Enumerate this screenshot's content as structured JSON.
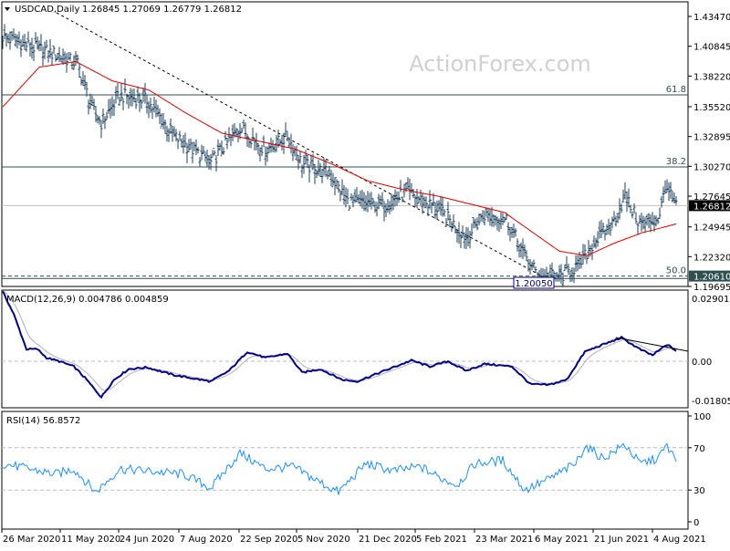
{
  "chart_data": [
    {
      "type": "ohlc",
      "title": "USDCAD,Daily",
      "ohlc_header": "1.26845 1.27069 1.26779 1.26812",
      "watermark": "ActionForex.com",
      "ylim": [
        1.19695,
        1.4347
      ],
      "y_ticks": [
        "1.43470",
        "1.40845",
        "1.38220",
        "1.35520",
        "1.32895",
        "1.30270",
        "1.27645",
        "1.24945",
        "1.22320",
        "1.19695"
      ],
      "current_price": "1.26812",
      "level_label": "1.20610",
      "low_label": "1.20050",
      "fib_levels": [
        {
          "label": "61.8",
          "value": 1.3656
        },
        {
          "label": "38.2",
          "value": 1.3022
        },
        {
          "label": "50.0",
          "value": 1.2061
        }
      ],
      "bars": 370,
      "close_keypoints": [
        [
          0,
          1.417
        ],
        [
          14,
          1.409
        ],
        [
          29,
          1.401
        ],
        [
          41,
          1.393
        ],
        [
          49,
          1.353
        ],
        [
          54,
          1.341
        ],
        [
          64,
          1.365
        ],
        [
          79,
          1.361
        ],
        [
          94,
          1.329
        ],
        [
          114,
          1.306
        ],
        [
          130,
          1.337
        ],
        [
          144,
          1.317
        ],
        [
          156,
          1.329
        ],
        [
          164,
          1.305
        ],
        [
          179,
          1.296
        ],
        [
          189,
          1.272
        ],
        [
          209,
          1.268
        ],
        [
          221,
          1.28
        ],
        [
          239,
          1.265
        ],
        [
          254,
          1.24
        ],
        [
          264,
          1.26
        ],
        [
          276,
          1.256
        ],
        [
          286,
          1.224
        ],
        [
          294,
          1.206
        ],
        [
          306,
          1.206
        ],
        [
          316,
          1.216
        ],
        [
          324,
          1.236
        ],
        [
          334,
          1.252
        ],
        [
          341,
          1.276
        ],
        [
          349,
          1.252
        ],
        [
          359,
          1.256
        ],
        [
          364,
          1.288
        ],
        [
          366,
          1.276
        ],
        [
          369,
          1.268
        ]
      ],
      "ma_keypoints": [
        [
          0,
          1.355
        ],
        [
          20,
          1.39
        ],
        [
          40,
          1.395
        ],
        [
          60,
          1.378
        ],
        [
          80,
          1.37
        ],
        [
          100,
          1.35
        ],
        [
          120,
          1.332
        ],
        [
          140,
          1.325
        ],
        [
          160,
          1.318
        ],
        [
          180,
          1.305
        ],
        [
          200,
          1.29
        ],
        [
          220,
          1.282
        ],
        [
          240,
          1.276
        ],
        [
          260,
          1.268
        ],
        [
          275,
          1.262
        ],
        [
          290,
          1.245
        ],
        [
          305,
          1.228
        ],
        [
          320,
          1.224
        ],
        [
          335,
          1.235
        ],
        [
          350,
          1.244
        ],
        [
          369,
          1.252
        ]
      ]
    },
    {
      "type": "line",
      "title": "MACD(12,26,9) 0.004786 0.004859",
      "ylim": [
        -0.018055,
        0.029018
      ],
      "y_ticks": [
        "0.029018",
        "0.00",
        "-0.018055"
      ],
      "macd_keypoints": [
        [
          0,
          0.032
        ],
        [
          6,
          0.0218
        ],
        [
          13,
          0.0056
        ],
        [
          19,
          0.0056
        ],
        [
          24,
          0.0016
        ],
        [
          31,
          0
        ],
        [
          39,
          -0.0024
        ],
        [
          46,
          -0.0085
        ],
        [
          54,
          -0.0165
        ],
        [
          61,
          -0.0085
        ],
        [
          69,
          -0.0036
        ],
        [
          79,
          -0.0028
        ],
        [
          94,
          -0.0064
        ],
        [
          114,
          -0.0093
        ],
        [
          124,
          -0.0044
        ],
        [
          134,
          0.0044
        ],
        [
          144,
          0.0016
        ],
        [
          156,
          0.0036
        ],
        [
          164,
          -0.0052
        ],
        [
          174,
          -0.0036
        ],
        [
          186,
          -0.0085
        ],
        [
          194,
          -0.0093
        ],
        [
          209,
          -0.0044
        ],
        [
          224,
          0.0004
        ],
        [
          234,
          -0.0024
        ],
        [
          244,
          0
        ],
        [
          254,
          -0.0044
        ],
        [
          264,
          -0.0012
        ],
        [
          279,
          -0.0024
        ],
        [
          289,
          -0.0105
        ],
        [
          299,
          -0.0109
        ],
        [
          309,
          -0.0085
        ],
        [
          319,
          0.0044
        ],
        [
          329,
          0.0077
        ],
        [
          339,
          0.0109
        ],
        [
          349,
          0.0056
        ],
        [
          356,
          0.0028
        ],
        [
          364,
          0.0077
        ],
        [
          369,
          0.0048
        ]
      ]
    },
    {
      "type": "line",
      "title": "RSI(14) 56.8572",
      "ylim": [
        0,
        100
      ],
      "y_ticks": [
        "100",
        "70",
        "30",
        "0"
      ],
      "rsi_keypoints": [
        [
          0,
          55
        ],
        [
          14,
          50
        ],
        [
          29,
          45
        ],
        [
          39,
          50
        ],
        [
          51,
          28
        ],
        [
          64,
          50
        ],
        [
          79,
          48
        ],
        [
          99,
          45
        ],
        [
          114,
          32
        ],
        [
          130,
          65
        ],
        [
          144,
          50
        ],
        [
          159,
          52
        ],
        [
          171,
          40
        ],
        [
          184,
          28
        ],
        [
          199,
          55
        ],
        [
          214,
          48
        ],
        [
          229,
          52
        ],
        [
          239,
          42
        ],
        [
          249,
          35
        ],
        [
          259,
          55
        ],
        [
          274,
          58
        ],
        [
          286,
          30
        ],
        [
          299,
          40
        ],
        [
          314,
          55
        ],
        [
          319,
          72
        ],
        [
          329,
          60
        ],
        [
          341,
          73
        ],
        [
          349,
          55
        ],
        [
          359,
          60
        ],
        [
          364,
          72
        ],
        [
          369,
          57
        ]
      ]
    }
  ],
  "x_axis": [
    "26 Mar 2020",
    "11 May 2020",
    "24 Jun 2020",
    "7 Aug 2020",
    "22 Sep 2020",
    "5 Nov 2020",
    "21 Dec 2020",
    "5 Feb 2021",
    "23 Mar 2021",
    "6 May 2021",
    "21 Jun 2021",
    "4 Aug 2021"
  ]
}
